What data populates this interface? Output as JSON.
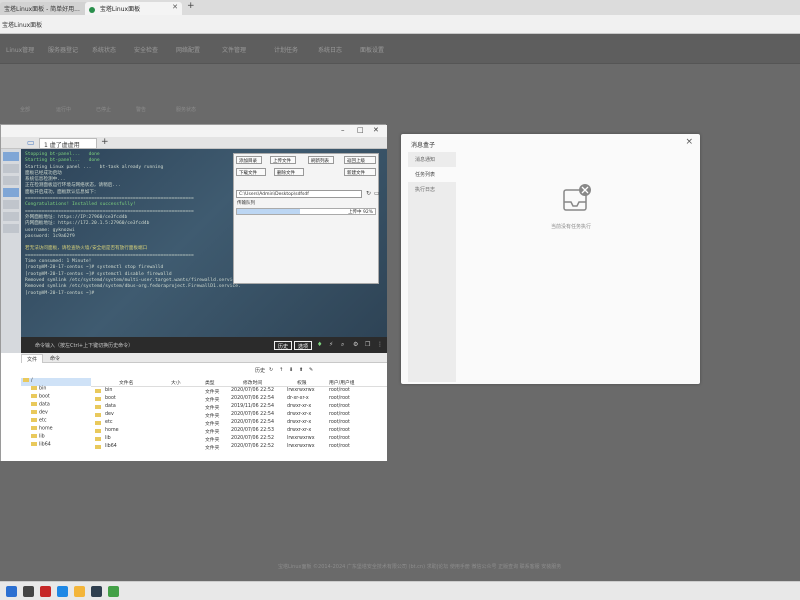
{
  "browser": {
    "tabs": [
      {
        "title": "宝塔Linux面板 - 简单好用..."
      },
      {
        "title": "宝塔Linux面板",
        "active": true
      }
    ],
    "new_tab": "+",
    "address": "宝塔Linux面板"
  },
  "page": {
    "nav": [
      "Linux管理",
      "服务器登记",
      "系统状态",
      "安全检查",
      "网络配置",
      "文件管理",
      "计划任务",
      "系统日志",
      "面板设置"
    ],
    "subnav": [
      "全部",
      "运行中",
      "已停止",
      "警告",
      "服务状态"
    ],
    "footer": "宝塔Linux面板 ©2014-2024 广东堡塔安全技术有限公司 (bt.cn)     求助|论坛     使用手册     微信公众号     正版查询     联系客服     安装服务"
  },
  "messages": {
    "title": "消息盒子",
    "sidebar": [
      {
        "label": "消息通知"
      },
      {
        "label": "任务列表",
        "active": true
      },
      {
        "label": "执行日志"
      }
    ],
    "empty_text": "当前没有任务执行"
  },
  "app": {
    "tab_label": "1 虚了虚虚用",
    "new_tab": "+",
    "terminal_lines": [
      {
        "text": "Stopping bt-panel...   done",
        "style": "green"
      },
      {
        "text": "Starting bt-panel...   done",
        "style": "green"
      },
      {
        "text": "Starting Linux panel ...   bt-task already running",
        "style": ""
      },
      {
        "text": "面板已经成功启动",
        "style": ""
      },
      {
        "text": "系统信息检测中...",
        "style": ""
      },
      {
        "text": "正在检测面板运行环境与网络状态，请稍后...",
        "style": ""
      },
      {
        "text": "面板开启成功，面板默认信息如下：",
        "style": ""
      },
      {
        "text": "=============================================================",
        "style": ""
      },
      {
        "text": "Congratulations! Installed successfully!",
        "style": "green"
      },
      {
        "text": "=============================================================",
        "style": ""
      },
      {
        "text": "外网面板地址: https://IP:27960/ce3fcd4b",
        "style": ""
      },
      {
        "text": "内网面板地址: https://172.20.1.5:27960/ce3fcd4b",
        "style": ""
      },
      {
        "text": "username: gyknozwi",
        "style": ""
      },
      {
        "text": "password: 1c9a62f9",
        "style": ""
      },
      {
        "text": "",
        "style": ""
      },
      {
        "text": "若无法访问面板，请检查防火墙/安全组是否有放行面板端口",
        "style": "yellow"
      },
      {
        "text": "=============================================================",
        "style": ""
      },
      {
        "text": "Time consumed: 1 Minute!",
        "style": ""
      },
      {
        "text": "[root@VM-20-17-centos ~]# systemctl stop firewalld",
        "style": ""
      },
      {
        "text": "[root@VM-20-17-centos ~]# systemctl disable firewalld",
        "style": ""
      },
      {
        "text": "Removed symlink /etc/systemd/system/multi-user.target.wants/firewalld.service.",
        "style": ""
      },
      {
        "text": "Removed symlink /etc/systemd/system/dbus-org.fedoraproject.FirewallD1.service.",
        "style": ""
      },
      {
        "text": "[root@VM-20-17-centos ~]# ",
        "style": ""
      }
    ],
    "sftp": {
      "buttons": [
        "添加目录",
        "上传文件",
        "刷新列表",
        "返回上级",
        "下载文件",
        "删除文件",
        "新建文件"
      ],
      "path": "C:\\Users\\Admin\\Desktop\\sdfsdf",
      "section_label": "传输队列",
      "progress_text": "上传中 92%",
      "progress": 0.92
    },
    "cmd_placeholder": "命令输入（按左Ctrl+上下键切换历史命令）",
    "cmd_buttons": [
      "历史",
      "选项"
    ],
    "fm_tabs": [
      "文件",
      "命令"
    ],
    "fm_toolbar": [
      "历史",
      "↻",
      "↑",
      "⬇",
      "⬆",
      "✎"
    ],
    "tree": [
      {
        "name": "/",
        "sel": true
      },
      {
        "name": "bin"
      },
      {
        "name": "boot"
      },
      {
        "name": "data"
      },
      {
        "name": "dev"
      },
      {
        "name": "etc"
      },
      {
        "name": "home"
      },
      {
        "name": "lib"
      },
      {
        "name": "lib64"
      }
    ],
    "columns": [
      "文件名",
      "大小",
      "类型",
      "修改时间",
      "权限",
      "用户/用户组"
    ],
    "files": [
      {
        "name": "bin",
        "size": "",
        "type": "文件夹",
        "mtime": "2020/07/06 22:52",
        "perm": "lrwxrwxrwx",
        "owner": "root/root"
      },
      {
        "name": "boot",
        "size": "",
        "type": "文件夹",
        "mtime": "2020/07/06 22:54",
        "perm": "dr-xr-xr-x",
        "owner": "root/root"
      },
      {
        "name": "data",
        "size": "",
        "type": "文件夹",
        "mtime": "2019/11/06 22:54",
        "perm": "drwxr-xr-x",
        "owner": "root/root"
      },
      {
        "name": "dev",
        "size": "",
        "type": "文件夹",
        "mtime": "2020/07/06 22:54",
        "perm": "drwxr-xr-x",
        "owner": "root/root"
      },
      {
        "name": "etc",
        "size": "",
        "type": "文件夹",
        "mtime": "2020/07/06 22:54",
        "perm": "drwxr-xr-x",
        "owner": "root/root"
      },
      {
        "name": "home",
        "size": "",
        "type": "文件夹",
        "mtime": "2020/07/06 22:53",
        "perm": "drwxr-xr-x",
        "owner": "root/root"
      },
      {
        "name": "lib",
        "size": "",
        "type": "文件夹",
        "mtime": "2020/07/06 22:52",
        "perm": "lrwxrwxrwx",
        "owner": "root/root"
      },
      {
        "name": "lib64",
        "size": "",
        "type": "文件夹",
        "mtime": "2020/07/06 22:52",
        "perm": "lrwxrwxrwx",
        "owner": "root/root"
      }
    ]
  },
  "taskbar": {
    "icons": [
      {
        "name": "start-icon",
        "color": "#2b6fd1"
      },
      {
        "name": "search-icon",
        "color": "#444444"
      },
      {
        "name": "taskview-icon",
        "color": "#c62828"
      },
      {
        "name": "edge-icon",
        "color": "#1e88e5"
      },
      {
        "name": "explorer-icon",
        "color": "#f3b53a"
      },
      {
        "name": "terminal-icon",
        "color": "#2f3f4f"
      },
      {
        "name": "store-icon",
        "color": "#43a047"
      }
    ]
  }
}
